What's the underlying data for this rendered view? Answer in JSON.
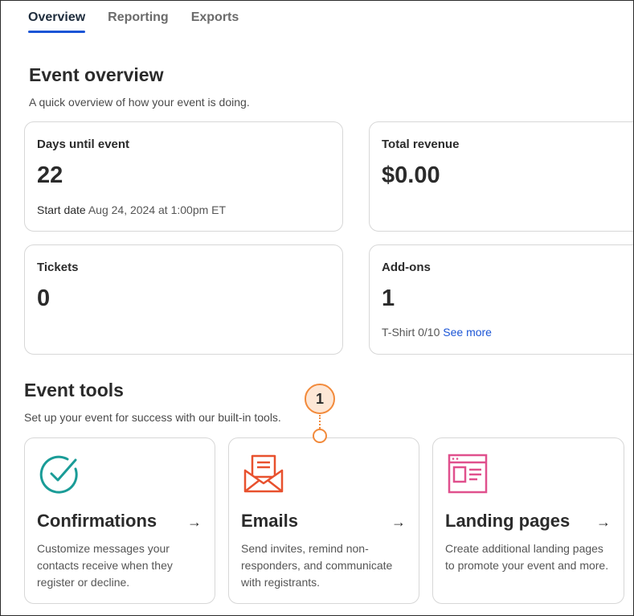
{
  "tabs": [
    {
      "label": "Overview",
      "active": true
    },
    {
      "label": "Reporting",
      "active": false
    },
    {
      "label": "Exports",
      "active": false
    }
  ],
  "overview": {
    "title": "Event overview",
    "subtitle": "A quick overview of how your event is doing.",
    "stats": {
      "days": {
        "label": "Days until event",
        "value": "22",
        "foot_strong": "Start date",
        "foot_text": "Aug 24, 2024 at 1:00pm ET"
      },
      "revenue": {
        "label": "Total revenue",
        "value": "$0.00"
      },
      "tickets": {
        "label": "Tickets",
        "value": "0"
      },
      "addons": {
        "label": "Add-ons",
        "value": "1",
        "foot_text": "T-Shirt 0/10",
        "foot_link": "See more"
      }
    }
  },
  "tools": {
    "title": "Event tools",
    "subtitle": "Set up your event for success with our built-in tools.",
    "items": [
      {
        "title": "Confirmations",
        "arrow": "→",
        "desc": "Customize messages your contacts receive when they register or decline.",
        "icon": "checkmark-circle-icon",
        "color": "#1a9c97"
      },
      {
        "title": "Emails",
        "arrow": "→",
        "desc": "Send invites, remind non-responders, and communicate with registrants.",
        "icon": "envelope-icon",
        "color": "#e8512e"
      },
      {
        "title": "Landing pages",
        "arrow": "→",
        "desc": "Create additional landing pages to promote your event and more.",
        "icon": "webpage-icon",
        "color": "#e0508d"
      }
    ]
  },
  "callout": {
    "number": "1",
    "color": "#f28a3b"
  },
  "colors": {
    "accent": "#1b55d6",
    "border": "#d7d7d7"
  }
}
